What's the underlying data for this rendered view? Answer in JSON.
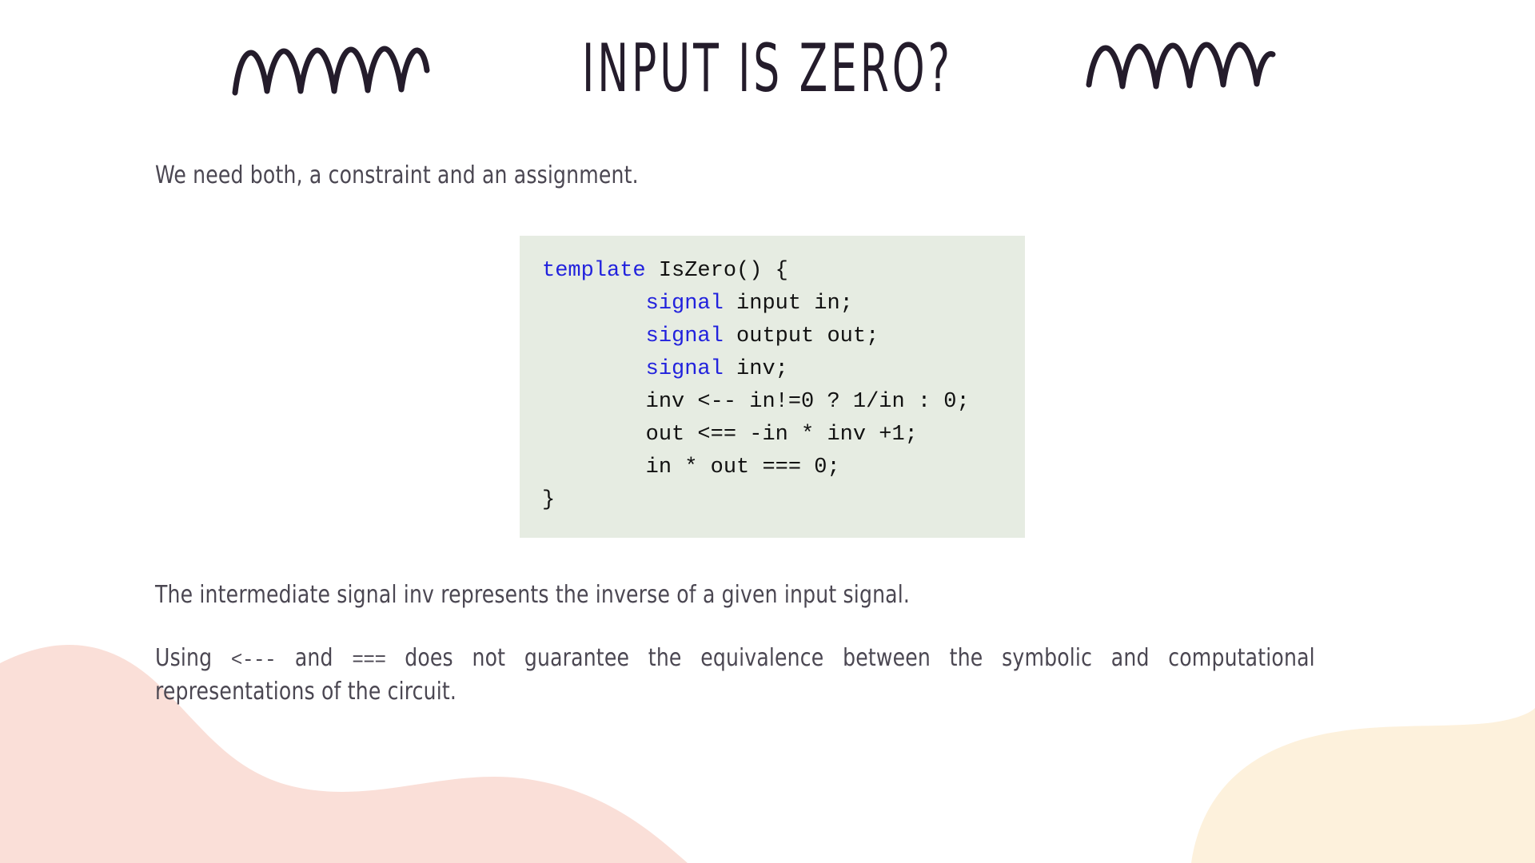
{
  "slide": {
    "title": "INPUT IS ZERO?",
    "background_color": "#ffffff",
    "title_color": "#241c2b"
  },
  "decorations": {
    "squiggle_left": "zigzag-squiggle",
    "squiggle_right": "zigzag-squiggle",
    "squiggle_color": "#241c2b",
    "blob_bottom_left": "pink-blob",
    "blob_bottom_left_color": "#fadfd8",
    "blob_bottom_right": "cream-blob",
    "blob_bottom_right_color": "#fdf1dc"
  },
  "body": {
    "intro_paragraph": "We need both, a constraint and an assignment.",
    "middle_paragraph": "The intermediate signal inv represents the inverse of a given input signal.",
    "last_paragraph": {
      "part1": "Using ",
      "code1": "<---",
      "part2": " and ",
      "code2": "===",
      "part3": " does not guarantee the equivalence between the symbolic and computational representations of the circuit."
    }
  },
  "code_block": {
    "background_color": "#e6ece2",
    "keyword_color": "#2222dd",
    "text_color": "#111111",
    "language": "circom",
    "lines": [
      {
        "keyword": "template",
        "rest": " IsZero() {"
      },
      {
        "indent": "        ",
        "keyword": "signal",
        "rest": " input in;"
      },
      {
        "indent": "        ",
        "keyword": "signal",
        "rest": " output out;"
      },
      {
        "indent": "        ",
        "keyword": "signal",
        "rest": " inv;"
      },
      {
        "indent": "        ",
        "keyword": "",
        "rest": "inv <-- in!=0 ? 1/in : 0;"
      },
      {
        "indent": "        ",
        "keyword": "",
        "rest": "out <== -in * inv +1;"
      },
      {
        "indent": "        ",
        "keyword": "",
        "rest": "in * out === 0;"
      },
      {
        "indent": "",
        "keyword": "",
        "rest": "}"
      }
    ],
    "plain_text": "template IsZero() {\n        signal input in;\n        signal output out;\n        signal inv;\n        inv <-- in!=0 ? 1/in : 0;\n        out <== -in * inv +1;\n        in * out === 0;\n}"
  }
}
